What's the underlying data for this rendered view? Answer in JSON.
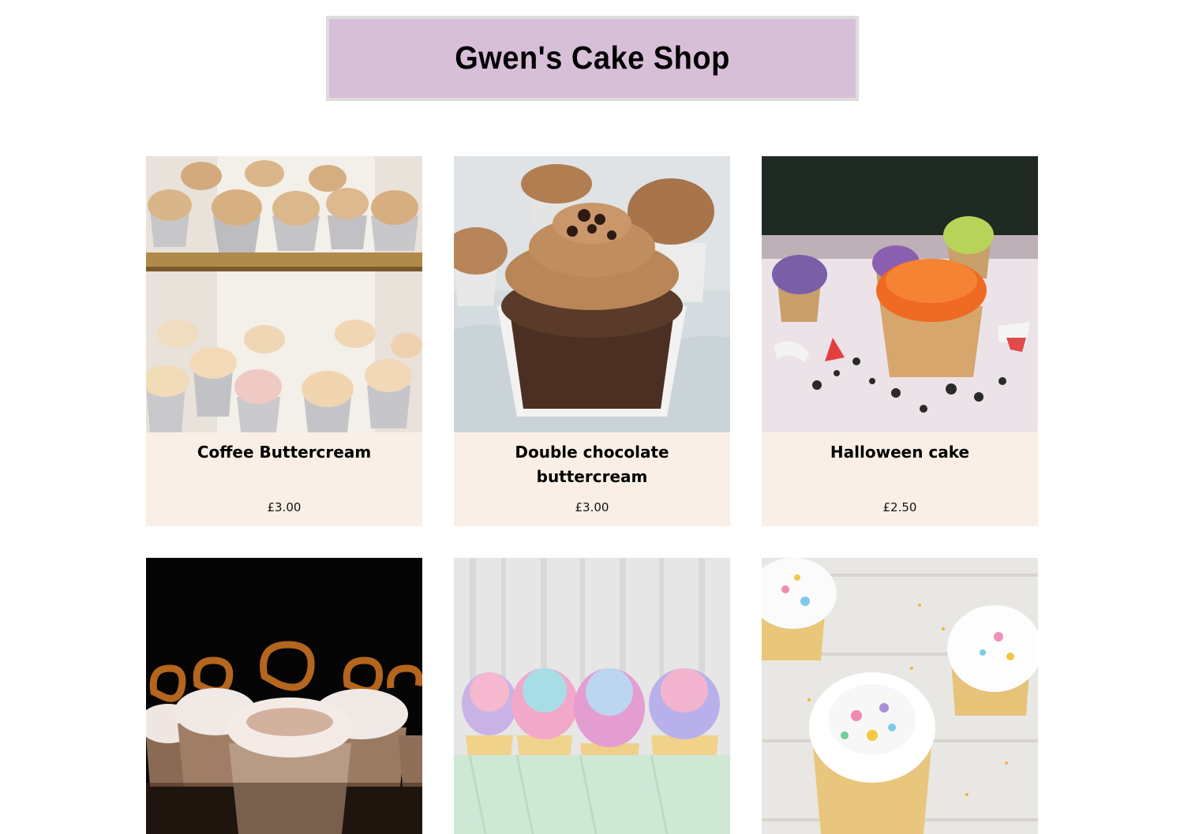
{
  "header": {
    "title": "Gwen's Cake Shop"
  },
  "products": [
    {
      "name": "Coffee Buttercream",
      "price": "£3.00",
      "image": "coffee-cupcakes-photo"
    },
    {
      "name": "Double chocolate buttercream",
      "price": "£3.00",
      "image": "chocolate-cupcake-photo"
    },
    {
      "name": "Halloween cake",
      "price": "£2.50",
      "image": "halloween-cupcake-photo"
    },
    {
      "name": "",
      "price": "",
      "image": "pretzel-cupcakes-photo"
    },
    {
      "name": "",
      "price": "",
      "image": "rainbow-cupcakes-photo"
    },
    {
      "name": "",
      "price": "",
      "image": "sprinkle-cupcakes-photo"
    }
  ],
  "colors": {
    "header_bg": "#d8bfd8",
    "header_border": "#dcdcdc",
    "card_body_bg": "#faefe6"
  }
}
